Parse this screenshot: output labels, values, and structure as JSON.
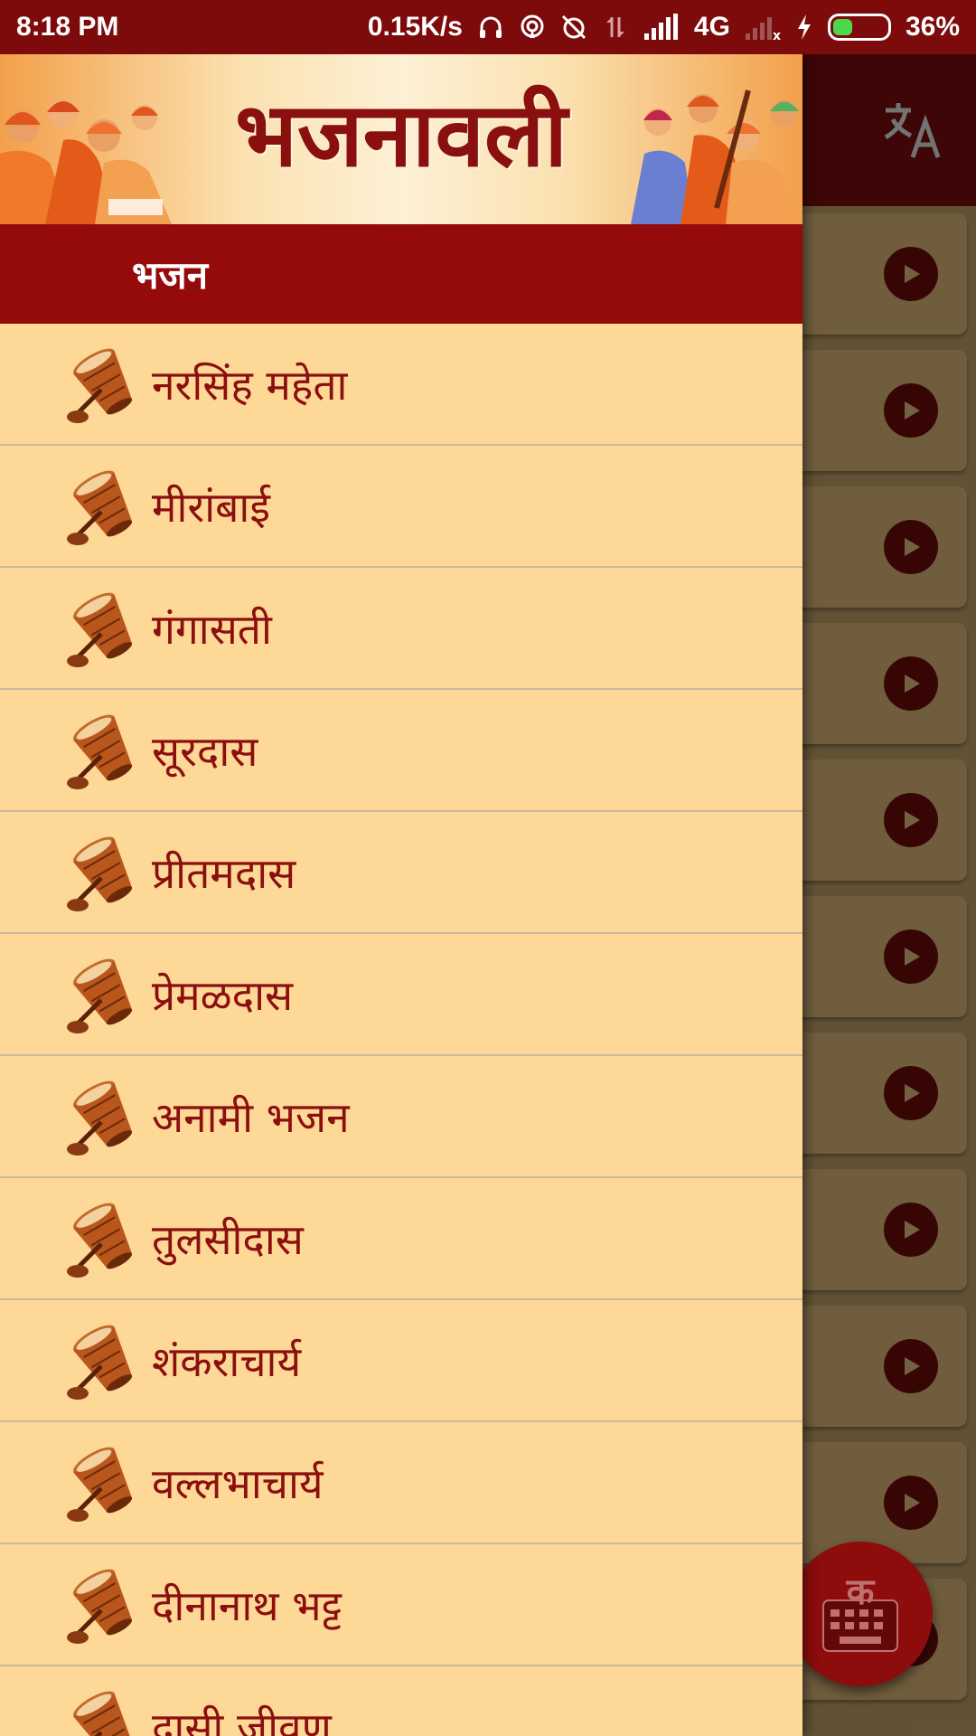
{
  "status_bar": {
    "time": "8:18 PM",
    "net_speed": "0.15K/s",
    "network": "4G",
    "battery": "36%",
    "battery_level": 0.36
  },
  "app": {
    "title": "भजनावली",
    "translate_icon": "translate-icon",
    "fab_glyph": "क"
  },
  "drawer": {
    "section_title": "भजन",
    "items": [
      {
        "label": "नरसिंह महेता"
      },
      {
        "label": "मीरांबाई"
      },
      {
        "label": "गंगासती"
      },
      {
        "label": "सूरदास"
      },
      {
        "label": "प्रीतमदास"
      },
      {
        "label": "प्रेमळदास"
      },
      {
        "label": "अनामी भजन"
      },
      {
        "label": "तुलसीदास"
      },
      {
        "label": "शंकराचार्य"
      },
      {
        "label": "वल्लभाचार्य"
      },
      {
        "label": "दीनानाथ भट्ट"
      },
      {
        "label": "दासी जीवण"
      }
    ]
  },
  "colors": {
    "primary": "#950b0b",
    "drawer_bg": "#fed897",
    "text": "#8b0f0f"
  }
}
